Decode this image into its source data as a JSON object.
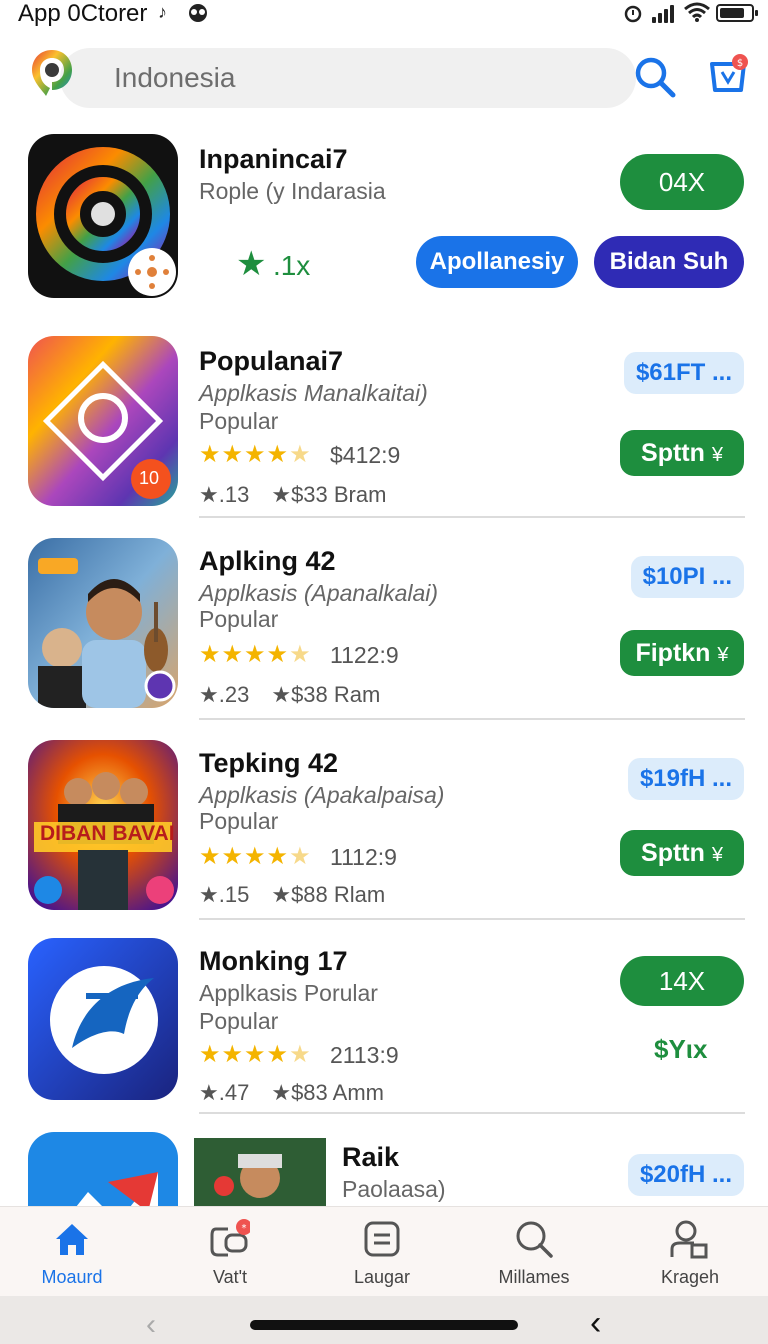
{
  "status_bar": {
    "title": "App 0Ctorer"
  },
  "search": {
    "value": "Indonesia"
  },
  "colors": {
    "accent_blue": "#1a73e8",
    "green": "#1e8e3e",
    "indigo": "#2f2bb5",
    "star": "#f4b400"
  },
  "featured": {
    "name": "Inpanincai7",
    "subtitle": "Rople (y Indarasia",
    "rating_label": ".1x",
    "primary_action": "04X",
    "tag_1": "Apollanesiy",
    "tag_2": "Bidan Suh"
  },
  "apps": [
    {
      "name": "Populanai7",
      "subtitle": "Applkasis Manalkaitai)",
      "category": "Popular",
      "rating": "$412:9",
      "meta_1": "13",
      "meta_2": "$33 Bram",
      "price": "$61FT ...",
      "action": "Spttn",
      "action_icon": "¥",
      "icon_badge": "10"
    },
    {
      "name": "Aplking 42",
      "subtitle": "Applkasis (Apanalkalai)",
      "category": "Popular",
      "rating": "1122:9",
      "meta_1": "23",
      "meta_2": "$38 Ram",
      "price": "$10PI ...",
      "action": "Fiptkn",
      "action_icon": "¥"
    },
    {
      "name": "Tepking 42",
      "subtitle": "Applkasis (Apakalpaisa)",
      "category": "Popular",
      "rating": "1112:9",
      "meta_1": "15",
      "meta_2": "$88 Rlam",
      "price": "$19fH ...",
      "action": "Spttn",
      "action_icon": "¥",
      "icon_text": "DIBAN BAVAI"
    },
    {
      "name": "Monking 17",
      "subtitle": "Applkasis Porular",
      "category": "Popular",
      "rating": "2113:9",
      "meta_1": "47",
      "meta_2": "$83 Amm",
      "price_button": "14X",
      "price_green": "$Yιx"
    },
    {
      "name": "Raik",
      "subtitle": "Paolaasa)",
      "price": "$20fH ..."
    }
  ],
  "bottom_nav": [
    {
      "label": "Moaurd",
      "icon": "home-icon",
      "active": true
    },
    {
      "label": "Vat't",
      "icon": "games-icon",
      "badge": true
    },
    {
      "label": "Laugar",
      "icon": "list-icon"
    },
    {
      "label": "Millames",
      "icon": "search-icon"
    },
    {
      "label": "Kragеh",
      "icon": "profile-icon"
    }
  ]
}
